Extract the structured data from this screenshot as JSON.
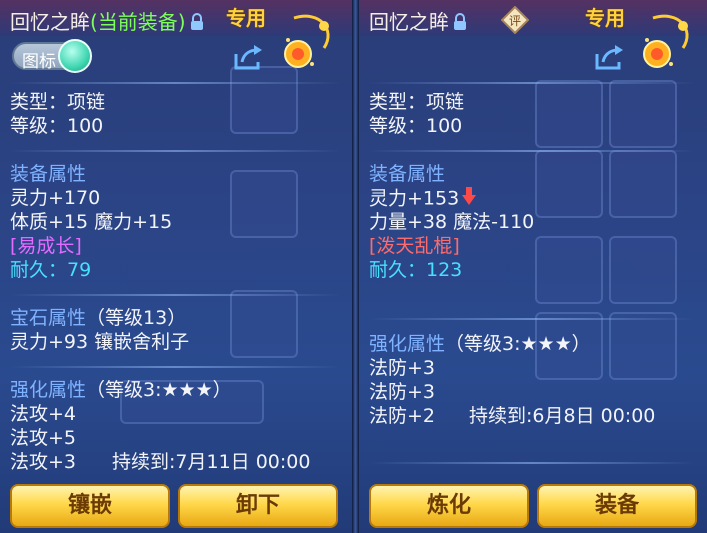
{
  "left": {
    "title": "回忆之眸",
    "current_tag": "(当前装备)",
    "exclusive": "专用",
    "toggle_label": "图标",
    "type_line": "类型：项链",
    "level_line": "等级：100",
    "equip_attr_title": "装备属性",
    "attr_line1": "灵力+170",
    "attr_line2": "体质+15 魔力+15",
    "special": "[易成长]",
    "durability": "耐久：79",
    "gem_title": "宝石属性",
    "gem_level": "（等级13）",
    "gem_line": "灵力+93 镶嵌舍利子",
    "enhance_title": "强化属性",
    "enhance_level": "（等级3:★★★）",
    "enhance1": "法攻+4",
    "enhance2": "法攻+5",
    "enhance3": "法攻+3",
    "enhance3_duration": "持续到:7月11日 00:00",
    "btn_left": "镶嵌",
    "btn_right": "卸下"
  },
  "right": {
    "title": "回忆之眸",
    "ping": "评",
    "exclusive": "专用",
    "type_line": "类型：项链",
    "level_line": "等级：100",
    "equip_attr_title": "装备属性",
    "attr_line1": "灵力+153",
    "attr_line2": "力量+38 魔法-110",
    "special": "[泼天乱棍]",
    "durability": "耐久：123",
    "enhance_title": "强化属性",
    "enhance_level": "（等级3:★★★）",
    "enhance1": "法防+3",
    "enhance2": "法防+3",
    "enhance3": "法防+2",
    "enhance3_duration": "持续到:6月8日 00:00",
    "btn_left": "炼化",
    "btn_right": "装备"
  },
  "colors": {
    "section_title": "#7fb2ff",
    "special_purple": "#e46bff",
    "special_red": "#ff6b6b",
    "durability": "#48e0ff",
    "current_tag": "#7dff5a",
    "exclusive": "#ffd23a"
  },
  "icons": [
    "lock-icon",
    "ping-badge-icon",
    "necklace-item-icon",
    "share-icon",
    "down-arrow-icon"
  ]
}
